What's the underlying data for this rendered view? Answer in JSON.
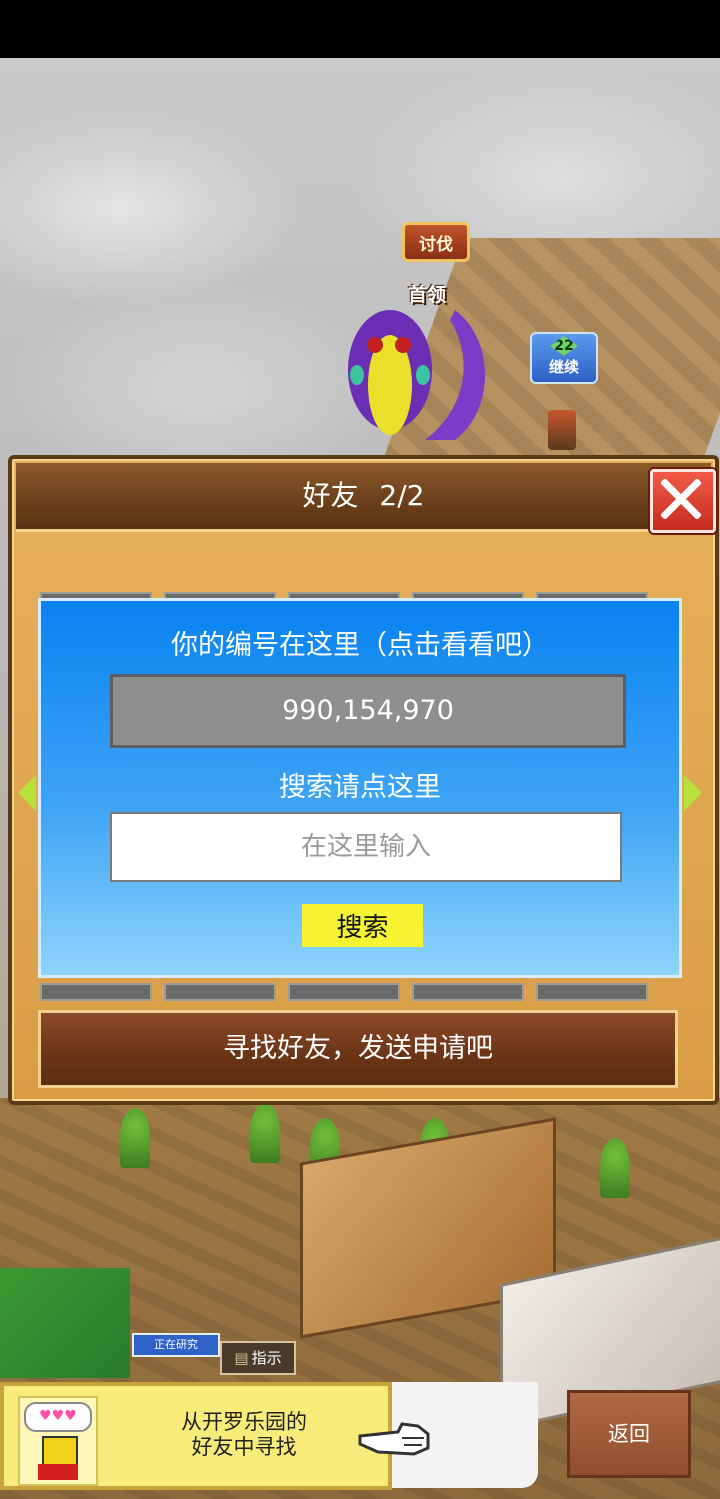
{
  "dialog": {
    "title": "好友",
    "page_indicator": "2/2",
    "close_icon": "close-x-icon",
    "id_caption": "你的编号在这里（点击看看吧）",
    "player_id": "990,154,970",
    "search_caption": "搜索请点这里",
    "search_placeholder": "在这里输入",
    "search_button": "搜索",
    "find_friends_button": "寻找好友，发送申请吧"
  },
  "map": {
    "quest_badge": "讨伐",
    "leader_label": "首领",
    "continue_level": "22",
    "continue_label": "继续"
  },
  "hud": {
    "research_status": "正在研究",
    "guide_button": "指示"
  },
  "bottom": {
    "hint_line1": "从开罗乐园的",
    "hint_line2": "好友中寻找",
    "mascot_hearts": "♥♥♥",
    "back_button": "返回"
  },
  "colors": {
    "panel_blue": "#0a82f2",
    "search_button_yellow": "#f6f330",
    "close_red": "#e0402f",
    "header_brown": "#6a3f1a"
  }
}
